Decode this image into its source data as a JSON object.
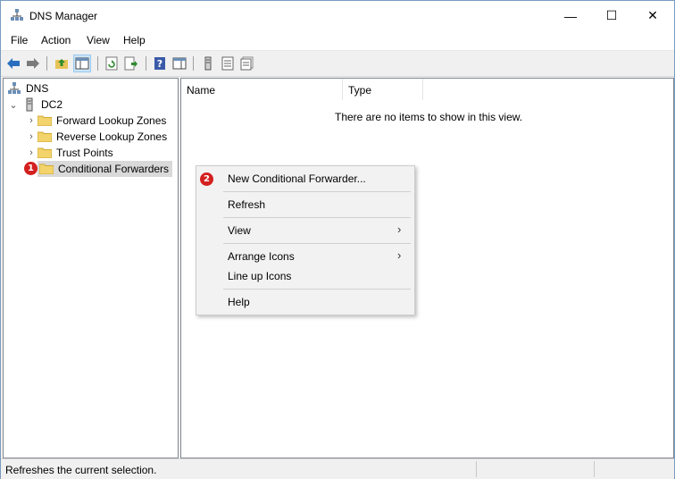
{
  "window": {
    "title": "DNS Manager",
    "controls": {
      "minimize": "—",
      "maximize": "☐",
      "close": "✕"
    }
  },
  "menu": [
    "File",
    "Action",
    "View",
    "Help"
  ],
  "toolbar": {
    "icons": [
      "back-icon",
      "forward-icon",
      "up-folder-icon",
      "show-hide-console-tree-icon",
      "refresh-icon",
      "export-list-icon",
      "help-icon",
      "action-pane-icon",
      "server-icon",
      "list-icon",
      "details-icon"
    ]
  },
  "tree": {
    "root": "DNS",
    "server": "DC2",
    "items": [
      "Forward Lookup Zones",
      "Reverse Lookup Zones",
      "Trust Points",
      "Conditional Forwarders"
    ]
  },
  "list": {
    "columns": [
      "Name",
      "Type"
    ],
    "empty_message": "There are no items to show in this view."
  },
  "context_menu": {
    "items": [
      "New Conditional Forwarder...",
      "Refresh",
      "View",
      "Arrange Icons",
      "Line up Icons",
      "Help"
    ]
  },
  "badges": {
    "one": "1",
    "two": "2"
  },
  "status": {
    "text": "Refreshes the current selection."
  },
  "colors": {
    "badge": "#d42020",
    "selection": "#d9d9d9",
    "folder": "#f3d36b"
  }
}
